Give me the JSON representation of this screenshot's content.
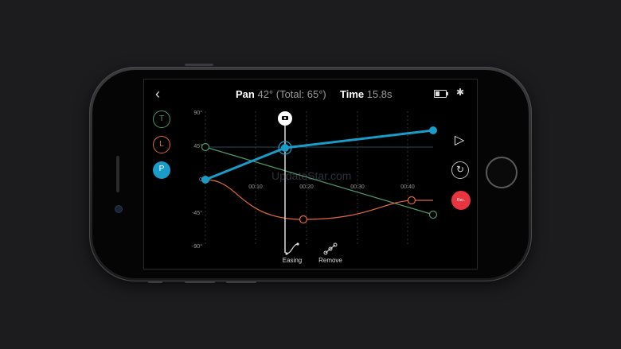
{
  "header": {
    "back_label": "‹",
    "pan_label": "Pan",
    "pan_value": "42° (Total: 65°)",
    "time_label": "Time",
    "time_value": "15.8s"
  },
  "axes": [
    {
      "label": "T",
      "color": "#4e9a6e"
    },
    {
      "label": "L",
      "color": "#e06a3e"
    },
    {
      "label": "P",
      "color": "#1a9cc9"
    }
  ],
  "chart": {
    "y_ticks": [
      "90°",
      "45°",
      "0",
      "-45°",
      "-90°"
    ],
    "x_ticks": [
      "00:10",
      "00:20",
      "00:30",
      "00:40"
    ]
  },
  "controls": {
    "play_icon": "play-icon",
    "reset_icon": "reset-icon",
    "rec_label": "Rec."
  },
  "tools": {
    "easing_label": "Easing",
    "remove_label": "Remove"
  },
  "watermark": "UpdateStar.com",
  "colors": {
    "pan": "#1a9cc9",
    "tilt": "#4e9a6e",
    "lean": "#e06a3e",
    "record": "#e8343f"
  }
}
